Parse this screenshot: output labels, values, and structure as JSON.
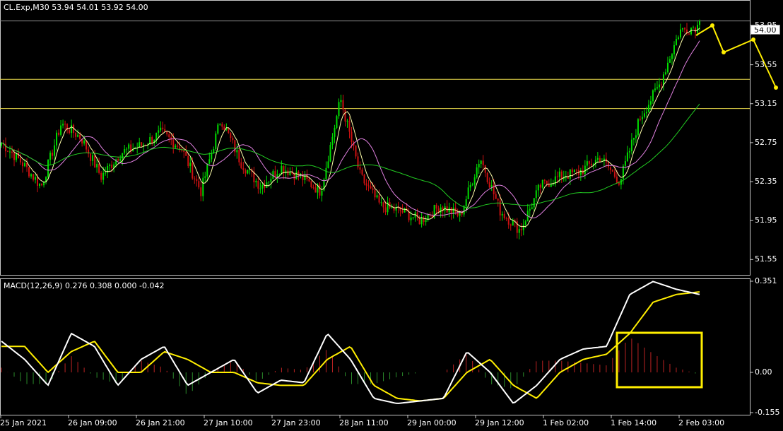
{
  "main_chart": {
    "title": "CL.Exp,M30  53.94 54.01 53.92 54.00",
    "current_price": "54.00",
    "y_ticks": [
      "53.95",
      "53.55",
      "53.15",
      "52.75",
      "52.35",
      "51.95",
      "51.55"
    ],
    "colors": {
      "bull": "#00dd00",
      "bear": "#cc1111",
      "horizontal_lines": "#e8d84a",
      "price_line": "#8a8a8a",
      "arrows": "#ffee00"
    }
  },
  "macd_chart": {
    "title": "MACD(12,26,9) 0.276 0.308 0.000 -0.042",
    "y_ticks": [
      "0.351",
      "0.00",
      "-0.155"
    ],
    "colors": {
      "macd": "#ffffff",
      "signal": "#ffee00",
      "hist_pos": "#bb2222",
      "hist_neg": "#2a8a2a",
      "highlight": "#ffee00"
    }
  },
  "x_ticks": [
    "25 Jan 2021",
    "26 Jan 09:00",
    "26 Jan 21:00",
    "27 Jan 10:00",
    "27 Jan 23:00",
    "28 Jan 11:00",
    "29 Jan 00:00",
    "29 Jan 12:00",
    "1 Feb 02:00",
    "1 Feb 14:00",
    "2 Feb 03:00"
  ],
  "chart_data": [
    {
      "type": "candlestick",
      "title": "CL.Exp,M30",
      "ylim": [
        51.4,
        54.2
      ],
      "horizontal_levels": [
        53.4,
        53.1
      ],
      "last": {
        "open": 53.94,
        "high": 54.01,
        "low": 53.92,
        "close": 54.0
      },
      "x_labels": [
        "25 Jan 2021",
        "26 Jan 09:00",
        "26 Jan 21:00",
        "27 Jan 10:00",
        "27 Jan 23:00",
        "28 Jan 11:00",
        "29 Jan 00:00",
        "29 Jan 12:00",
        "1 Feb 02:00",
        "1 Feb 14:00",
        "2 Feb 03:00"
      ],
      "close_path": [
        52.75,
        52.55,
        52.3,
        52.95,
        52.8,
        52.4,
        52.65,
        52.72,
        52.85,
        52.7,
        52.25,
        53.0,
        52.55,
        52.3,
        52.5,
        52.4,
        52.25,
        53.2,
        52.4,
        52.1,
        52.05,
        51.95,
        52.1,
        52.0,
        52.6,
        52.05,
        51.85,
        52.3,
        52.4,
        52.45,
        52.6,
        52.35,
        53.0,
        53.35,
        53.9,
        53.95
      ],
      "moving_averages": [
        {
          "name": "",
          "color": "#ffffaa"
        },
        {
          "name": "",
          "color": "#e080e0"
        },
        {
          "name": "",
          "color": "#22cc22"
        }
      ]
    },
    {
      "type": "line",
      "title": "MACD(12,26,9)",
      "ylim": [
        -0.155,
        0.351
      ],
      "values": {
        "macd": 0.276,
        "signal": 0.308,
        "histogram_a": 0.0,
        "histogram_b": -0.042
      },
      "macd_path": [
        0.12,
        0.05,
        -0.05,
        0.15,
        0.1,
        -0.05,
        0.05,
        0.1,
        -0.05,
        0.0,
        0.05,
        -0.08,
        -0.03,
        -0.04,
        0.15,
        0.05,
        -0.1,
        -0.12,
        -0.11,
        -0.1,
        0.08,
        0.0,
        -0.12,
        -0.05,
        0.05,
        0.09,
        0.1,
        0.3,
        0.35,
        0.32,
        0.3
      ],
      "signal_path": [
        0.1,
        0.1,
        0.0,
        0.08,
        0.12,
        0.0,
        0.0,
        0.08,
        0.05,
        0.0,
        0.0,
        -0.04,
        -0.05,
        -0.05,
        0.05,
        0.1,
        -0.05,
        -0.1,
        -0.11,
        -0.1,
        0.0,
        0.05,
        -0.05,
        -0.1,
        0.0,
        0.05,
        0.07,
        0.15,
        0.27,
        0.3,
        0.31
      ]
    }
  ]
}
